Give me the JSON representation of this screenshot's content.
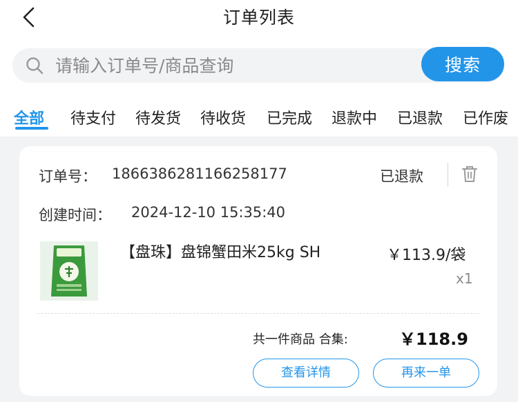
{
  "header": {
    "title": "订单列表",
    "back_icon": "chevron-left-icon"
  },
  "search": {
    "placeholder": "请输入订单号/商品查询",
    "value": "",
    "button_label": "搜索",
    "icon": "search-icon"
  },
  "tabs": [
    {
      "label": "全部",
      "active": true
    },
    {
      "label": "待支付",
      "active": false
    },
    {
      "label": "待发货",
      "active": false
    },
    {
      "label": "待收货",
      "active": false
    },
    {
      "label": "已完成",
      "active": false
    },
    {
      "label": "退款中",
      "active": false
    },
    {
      "label": "已退款",
      "active": false
    },
    {
      "label": "已作废",
      "active": false
    }
  ],
  "order": {
    "number_label": "订单号：",
    "number": "1866386281166258177",
    "status": "已退款",
    "created_label": "创建时间：",
    "created": "2024-12-10 15:35:40",
    "delete_icon": "trash-icon",
    "item": {
      "name": "【盘珠】盘锦蟹田米25kg SH",
      "price": "￥113.9",
      "unit": "/袋",
      "quantity": "x1",
      "thumbnail": "rice-bag-image"
    },
    "summary_label": "共一件商品  合集:",
    "total": "￥118.9",
    "buttons": {
      "details": "查看详情",
      "reorder": "再来一单"
    }
  },
  "colors": {
    "accent": "#2395e9",
    "background": "#f2f3f5",
    "card": "#ffffff"
  }
}
